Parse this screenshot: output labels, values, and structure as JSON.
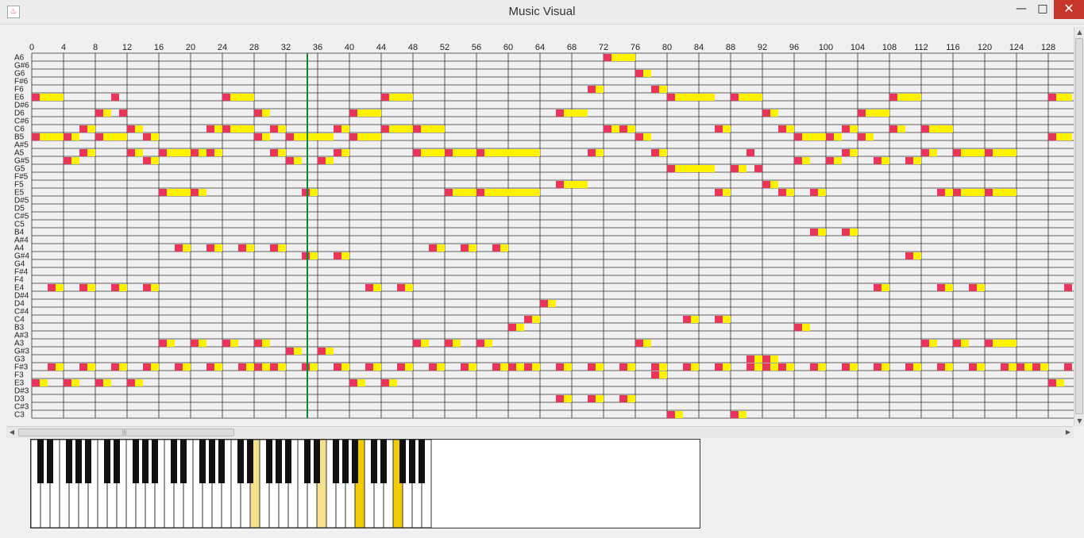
{
  "window": {
    "title": "Music Visual",
    "minimize_label": "—",
    "maximize_label": "□",
    "close_label": "✕",
    "icon": "java-app-icon"
  },
  "colors": {
    "grid_bg": "#f0f0f0",
    "grid_line": "#2f2f2f",
    "note_onset": "#e8365a",
    "note_sustain": "#fff200",
    "playhead": "#0b8a2c",
    "key_active": "#f2cc00",
    "key_recent": "#f6e08e"
  },
  "piano_roll": {
    "ticks": [
      "0",
      "4",
      "8",
      "12",
      "16",
      "20",
      "24",
      "28",
      "32",
      "36",
      "40",
      "44",
      "48",
      "52",
      "56",
      "60",
      "64",
      "68",
      "72",
      "76",
      "80",
      "84",
      "88",
      "92",
      "96",
      "100",
      "104",
      "108",
      "112",
      "116",
      "120",
      "124",
      "128"
    ],
    "pitches": [
      "A6",
      "G#6",
      "G6",
      "F#6",
      "F6",
      "E6",
      "D#6",
      "D6",
      "C#6",
      "C6",
      "B5",
      "A#5",
      "A5",
      "G#5",
      "G5",
      "F#5",
      "F5",
      "E5",
      "D#5",
      "D5",
      "C#5",
      "C5",
      "B4",
      "A#4",
      "A4",
      "G#4",
      "G4",
      "F#4",
      "F4",
      "E4",
      "D#4",
      "D4",
      "C#4",
      "C4",
      "B3",
      "A#3",
      "A3",
      "G#3",
      "G3",
      "F#3",
      "F3",
      "E3",
      "D#3",
      "D3",
      "C#3",
      "C3"
    ],
    "playhead_beat": 34.7,
    "notes": [
      [
        "A6",
        72,
        4
      ],
      [
        "G6",
        76,
        2
      ],
      [
        "F6",
        70,
        2
      ],
      [
        "F6",
        78,
        2
      ],
      [
        "E6",
        0,
        4
      ],
      [
        "E6",
        10,
        1
      ],
      [
        "E6",
        24,
        4
      ],
      [
        "E6",
        44,
        4
      ],
      [
        "E6",
        80,
        6
      ],
      [
        "E6",
        88,
        4
      ],
      [
        "E6",
        108,
        4
      ],
      [
        "E6",
        128,
        3
      ],
      [
        "D6",
        8,
        2
      ],
      [
        "D6",
        11,
        1
      ],
      [
        "D6",
        28,
        2
      ],
      [
        "D6",
        40,
        4
      ],
      [
        "D6",
        66,
        4
      ],
      [
        "D6",
        92,
        2
      ],
      [
        "D6",
        104,
        4
      ],
      [
        "C6",
        6,
        2
      ],
      [
        "C6",
        12,
        2
      ],
      [
        "C6",
        22,
        2
      ],
      [
        "C6",
        24,
        4
      ],
      [
        "C6",
        30,
        2
      ],
      [
        "C6",
        38,
        2
      ],
      [
        "C6",
        44,
        4
      ],
      [
        "C6",
        48,
        4
      ],
      [
        "C6",
        72,
        2
      ],
      [
        "C6",
        74,
        2
      ],
      [
        "C6",
        86,
        2
      ],
      [
        "C6",
        94,
        2
      ],
      [
        "C6",
        102,
        2
      ],
      [
        "C6",
        108,
        2
      ],
      [
        "C6",
        112,
        4
      ],
      [
        "B5",
        0,
        4
      ],
      [
        "B5",
        4,
        2
      ],
      [
        "B5",
        8,
        4
      ],
      [
        "B5",
        14,
        2
      ],
      [
        "B5",
        28,
        2
      ],
      [
        "B5",
        32,
        6
      ],
      [
        "B5",
        40,
        4
      ],
      [
        "B5",
        76,
        2
      ],
      [
        "B5",
        96,
        4
      ],
      [
        "B5",
        100,
        2
      ],
      [
        "B5",
        104,
        2
      ],
      [
        "B5",
        128,
        3
      ],
      [
        "A5",
        6,
        2
      ],
      [
        "A5",
        12,
        2
      ],
      [
        "A5",
        16,
        4
      ],
      [
        "A5",
        20,
        2
      ],
      [
        "A5",
        22,
        2
      ],
      [
        "A5",
        30,
        2
      ],
      [
        "A5",
        38,
        2
      ],
      [
        "A5",
        48,
        4
      ],
      [
        "A5",
        52,
        4
      ],
      [
        "A5",
        56,
        8
      ],
      [
        "A5",
        70,
        2
      ],
      [
        "A5",
        78,
        2
      ],
      [
        "A5",
        90,
        1
      ],
      [
        "A5",
        102,
        2
      ],
      [
        "A5",
        112,
        2
      ],
      [
        "A5",
        116,
        4
      ],
      [
        "A5",
        120,
        4
      ],
      [
        "G#5",
        4,
        2
      ],
      [
        "G#5",
        14,
        2
      ],
      [
        "G#5",
        32,
        2
      ],
      [
        "G#5",
        36,
        2
      ],
      [
        "G#5",
        96,
        2
      ],
      [
        "G#5",
        100,
        2
      ],
      [
        "G#5",
        106,
        2
      ],
      [
        "G#5",
        110,
        2
      ],
      [
        "G5",
        80,
        6
      ],
      [
        "G5",
        88,
        2
      ],
      [
        "G5",
        91,
        1
      ],
      [
        "F5",
        66,
        4
      ],
      [
        "F5",
        92,
        2
      ],
      [
        "E5",
        16,
        4
      ],
      [
        "E5",
        20,
        2
      ],
      [
        "E5",
        34,
        2
      ],
      [
        "E5",
        52,
        4
      ],
      [
        "E5",
        56,
        8
      ],
      [
        "E5",
        86,
        2
      ],
      [
        "E5",
        94,
        2
      ],
      [
        "E5",
        98,
        2
      ],
      [
        "E5",
        114,
        2
      ],
      [
        "E5",
        116,
        4
      ],
      [
        "E5",
        120,
        4
      ],
      [
        "B4",
        98,
        2
      ],
      [
        "B4",
        102,
        2
      ],
      [
        "A4",
        18,
        2
      ],
      [
        "A4",
        22,
        2
      ],
      [
        "A4",
        26,
        2
      ],
      [
        "A4",
        30,
        2
      ],
      [
        "A4",
        50,
        2
      ],
      [
        "A4",
        54,
        2
      ],
      [
        "A4",
        58,
        2
      ],
      [
        "G#4",
        34,
        2
      ],
      [
        "G#4",
        38,
        2
      ],
      [
        "G#4",
        110,
        2
      ],
      [
        "E4",
        2,
        2
      ],
      [
        "E4",
        6,
        2
      ],
      [
        "E4",
        10,
        2
      ],
      [
        "E4",
        14,
        2
      ],
      [
        "E4",
        42,
        2
      ],
      [
        "E4",
        46,
        2
      ],
      [
        "E4",
        106,
        2
      ],
      [
        "E4",
        114,
        2
      ],
      [
        "E4",
        118,
        2
      ],
      [
        "E4",
        130,
        1
      ],
      [
        "D4",
        64,
        2
      ],
      [
        "C4",
        62,
        2
      ],
      [
        "C4",
        82,
        2
      ],
      [
        "C4",
        86,
        2
      ],
      [
        "B3",
        60,
        2
      ],
      [
        "B3",
        96,
        2
      ],
      [
        "A3",
        16,
        2
      ],
      [
        "A3",
        20,
        2
      ],
      [
        "A3",
        24,
        2
      ],
      [
        "A3",
        28,
        2
      ],
      [
        "A3",
        48,
        2
      ],
      [
        "A3",
        52,
        2
      ],
      [
        "A3",
        56,
        2
      ],
      [
        "A3",
        76,
        2
      ],
      [
        "A3",
        112,
        2
      ],
      [
        "A3",
        116,
        2
      ],
      [
        "A3",
        120,
        4
      ],
      [
        "G#3",
        32,
        2
      ],
      [
        "G#3",
        36,
        2
      ],
      [
        "G3",
        90,
        2
      ],
      [
        "G3",
        92,
        2
      ],
      [
        "F#3",
        2,
        2
      ],
      [
        "F#3",
        6,
        2
      ],
      [
        "F#3",
        10,
        2
      ],
      [
        "F#3",
        14,
        2
      ],
      [
        "F#3",
        18,
        2
      ],
      [
        "F#3",
        22,
        2
      ],
      [
        "F#3",
        26,
        2
      ],
      [
        "F#3",
        28,
        2
      ],
      [
        "F#3",
        30,
        2
      ],
      [
        "F#3",
        34,
        2
      ],
      [
        "F#3",
        38,
        2
      ],
      [
        "F#3",
        42,
        2
      ],
      [
        "F#3",
        46,
        2
      ],
      [
        "F#3",
        50,
        2
      ],
      [
        "F#3",
        54,
        2
      ],
      [
        "F#3",
        58,
        2
      ],
      [
        "F#3",
        60,
        2
      ],
      [
        "F#3",
        62,
        2
      ],
      [
        "F#3",
        66,
        2
      ],
      [
        "F#3",
        70,
        2
      ],
      [
        "F#3",
        74,
        2
      ],
      [
        "F#3",
        78,
        2
      ],
      [
        "F#3",
        82,
        2
      ],
      [
        "F#3",
        86,
        2
      ],
      [
        "F#3",
        90,
        2
      ],
      [
        "F#3",
        92,
        2
      ],
      [
        "F#3",
        94,
        2
      ],
      [
        "F#3",
        98,
        2
      ],
      [
        "F#3",
        102,
        2
      ],
      [
        "F#3",
        106,
        2
      ],
      [
        "F#3",
        110,
        2
      ],
      [
        "F#3",
        114,
        2
      ],
      [
        "F#3",
        118,
        2
      ],
      [
        "F#3",
        122,
        2
      ],
      [
        "F#3",
        124,
        2
      ],
      [
        "F#3",
        126,
        2
      ],
      [
        "F#3",
        130,
        1
      ],
      [
        "F3",
        78,
        2
      ],
      [
        "E3",
        0,
        2
      ],
      [
        "E3",
        4,
        2
      ],
      [
        "E3",
        8,
        2
      ],
      [
        "E3",
        12,
        2
      ],
      [
        "E3",
        40,
        2
      ],
      [
        "E3",
        44,
        2
      ],
      [
        "E3",
        128,
        2
      ],
      [
        "D3",
        66,
        2
      ],
      [
        "D3",
        70,
        2
      ],
      [
        "D3",
        74,
        2
      ],
      [
        "C3",
        80,
        2
      ],
      [
        "C3",
        88,
        2
      ]
    ]
  },
  "keyboard": {
    "white_key_count": 42,
    "active_keys": [
      34,
      38
    ],
    "recent_keys": [
      23,
      30
    ]
  }
}
